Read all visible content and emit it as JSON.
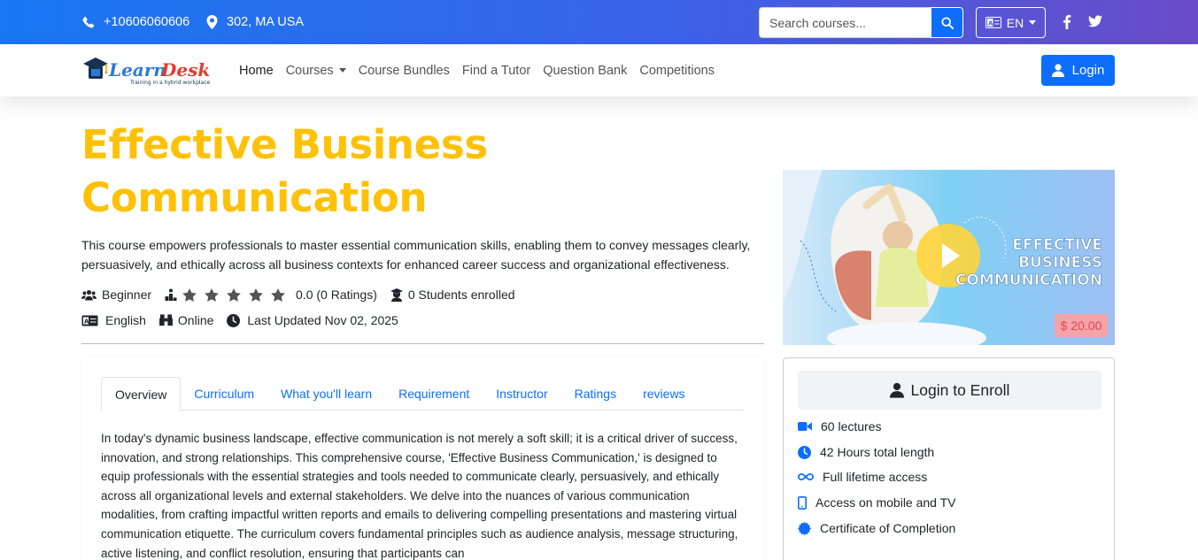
{
  "topbar": {
    "phone": "+10606060606",
    "address": "302, MA USA",
    "search_placeholder": "Search courses...",
    "language": "EN",
    "icons": [
      "phone-icon",
      "location-icon",
      "search-icon",
      "language-icon",
      "facebook-icon",
      "twitter-icon"
    ]
  },
  "nav": {
    "logo_text": "LearnDesk",
    "logo_tagline": "Training in a hybrid workplace",
    "items": [
      {
        "label": "Home",
        "active": true
      },
      {
        "label": "Courses",
        "dropdown": true
      },
      {
        "label": "Course Bundles"
      },
      {
        "label": "Find a Tutor"
      },
      {
        "label": "Question Bank"
      },
      {
        "label": "Competitions"
      }
    ],
    "login": "Login"
  },
  "course": {
    "title_line1": "Effective Business",
    "title_line2": "Communication",
    "description": "This course empowers professionals to master essential communication skills, enabling them to convey messages clearly, persuasively, and ethically across all business contexts for enhanced career success and organizational effectiveness.",
    "level": "Beginner",
    "rating_text": "0.0 (0 Ratings)",
    "stars": 5,
    "students": "0 Students enrolled",
    "language": "English",
    "mode": "Online",
    "last_updated": "Last Updated Nov 02, 2025"
  },
  "tabs": [
    "Overview",
    "Curriculum",
    "What you'll learn",
    "Requirement",
    "Instructor",
    "Ratings",
    "reviews"
  ],
  "overview_text": "In today's dynamic business landscape, effective communication is not merely a soft skill; it is a critical driver of success, innovation, and strong relationships. This comprehensive course, 'Effective Business Communication,' is designed to equip professionals with the essential strategies and tools needed to communicate clearly, persuasively, and ethically across all organizational levels and external stakeholders. We delve into the nuances of various communication modalities, from crafting impactful written reports and emails to delivering compelling presentations and mastering virtual communication etiquette. The curriculum covers fundamental principles such as audience analysis, message structuring, active listening, and conflict resolution, ensuring that participants can",
  "thumbnail": {
    "text_line1": "EFFECTIVE",
    "text_line2": "BUSINESS",
    "text_line3": "COMMUNICATION",
    "price": "$ 20.00"
  },
  "enroll": {
    "button": "Login to Enroll",
    "features": [
      {
        "icon": "video-icon",
        "label": "60 lectures"
      },
      {
        "icon": "clock-icon",
        "label": "42 Hours total length"
      },
      {
        "icon": "infinity-icon",
        "label": "Full lifetime access"
      },
      {
        "icon": "mobile-icon",
        "label": "Access on mobile and TV"
      },
      {
        "icon": "certificate-icon",
        "label": "Certificate of Completion"
      }
    ]
  },
  "colors": {
    "accent": "#0d6efd",
    "title": "#ffc107",
    "topbar_start": "#1877f2",
    "topbar_end": "#6a4cc8"
  }
}
